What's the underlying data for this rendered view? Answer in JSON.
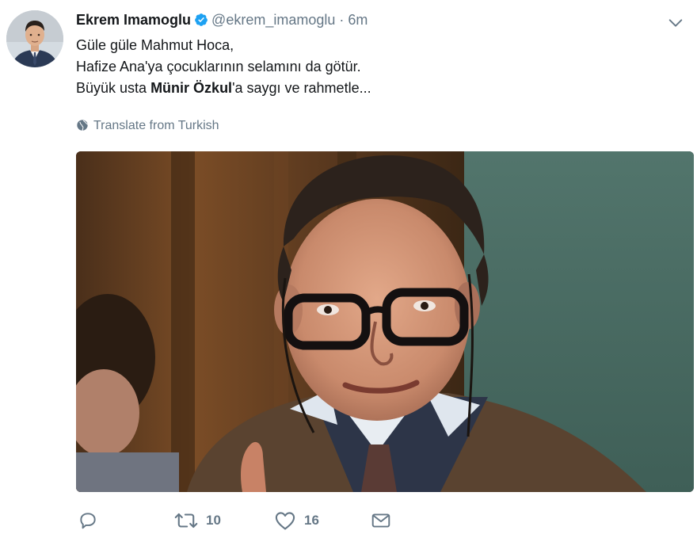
{
  "tweet": {
    "author_name": "Ekrem Imamoglu",
    "handle": "@ekrem_imamoglu",
    "separator": "·",
    "time": "6m",
    "text": {
      "line1": "Güle güle Mahmut Hoca,",
      "line2": "Hafize Ana'ya çocuklarının selamını da götür.",
      "line3_prefix": "Büyük usta ",
      "line3_bold": "Münir Özkul",
      "line3_suffix": "'a saygı ve rahmetle..."
    },
    "translate_label": "Translate from Turkish",
    "stats": {
      "retweets": "10",
      "likes": "16"
    }
  },
  "icons": {
    "verified": "verified-badge-icon",
    "caret": "chevron-down-icon",
    "globe": "globe-icon",
    "reply": "reply-icon",
    "retweet": "retweet-icon",
    "like": "heart-icon",
    "dm": "envelope-icon"
  },
  "colors": {
    "verified_blue": "#1da1f2",
    "secondary_text": "#657786",
    "primary_text": "#14171a"
  }
}
